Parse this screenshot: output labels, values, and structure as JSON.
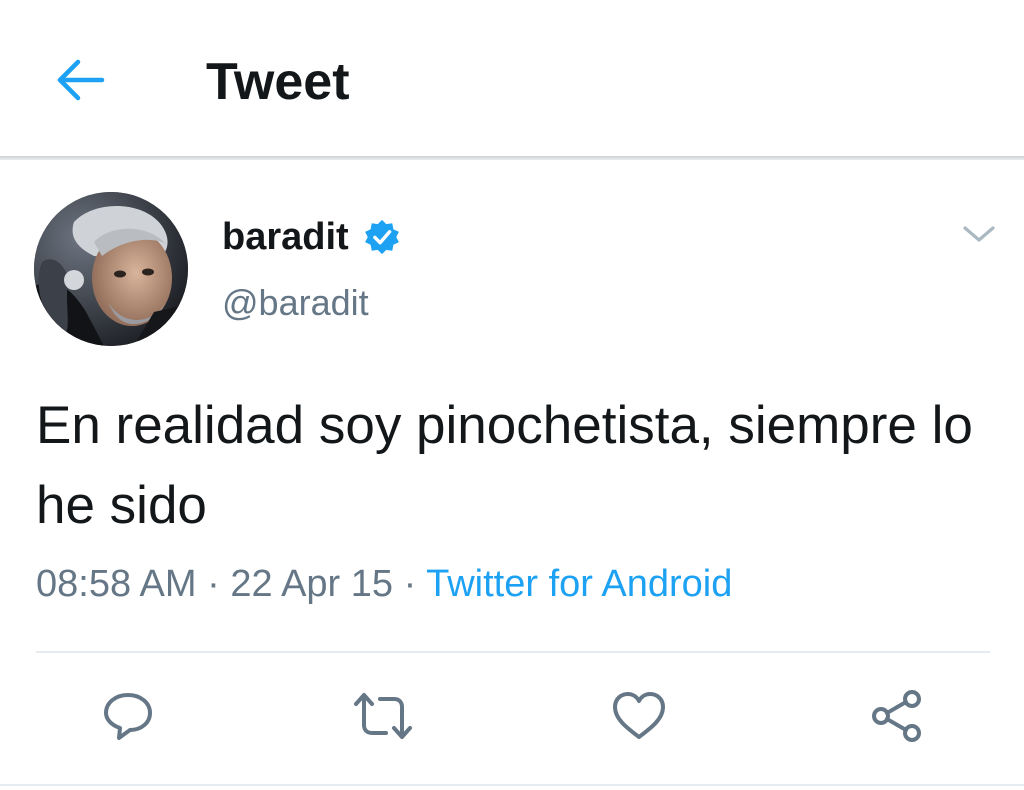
{
  "header": {
    "title": "Tweet",
    "back_icon": "arrow-left-icon"
  },
  "tweet": {
    "author": {
      "name": "baradit",
      "handle": "@baradit",
      "verified": true,
      "avatar_icon": "profile-photo"
    },
    "text": "En realidad soy pinochetista, siempre lo he sido",
    "time": "08:58 AM",
    "date": "22 Apr 15",
    "separator": "·",
    "source": "Twitter for Android",
    "actions": [
      {
        "icon": "reply-icon"
      },
      {
        "icon": "retweet-icon"
      },
      {
        "icon": "like-icon"
      },
      {
        "icon": "share-icon"
      }
    ]
  },
  "colors": {
    "accent": "#1da1f2",
    "text_primary": "#14171a",
    "text_secondary": "#657786",
    "icon_gray": "#657786",
    "divider": "#e6ecf0"
  }
}
